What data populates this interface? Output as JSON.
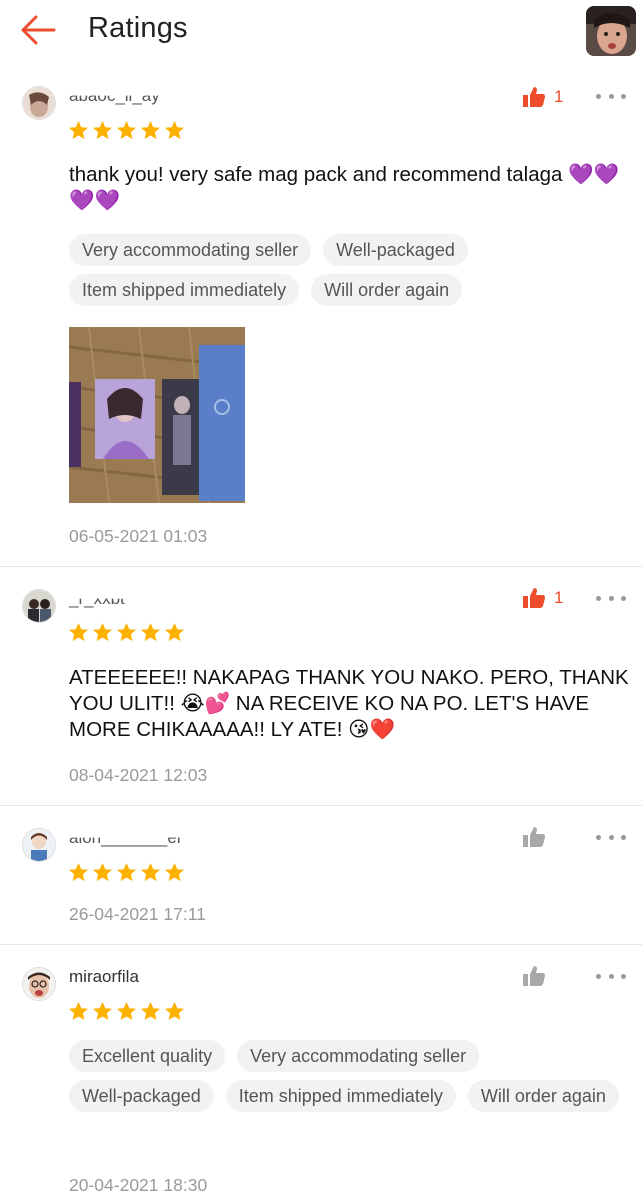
{
  "header": {
    "title": "Ratings"
  },
  "colors": {
    "accent": "#ee4d2d",
    "star": "#ffb100",
    "tag_bg": "#f2f2f2",
    "muted": "#9a9a9a"
  },
  "reviews": [
    {
      "username": "abaoc_ll_ay",
      "likes": "1",
      "liked": true,
      "rating": 5,
      "comment": "thank you! very safe mag pack and recommend talaga 💜💜💜💜",
      "tags": [
        "Very accommodating seller",
        "Well-packaged",
        "Item shipped immediately",
        "Will order again"
      ],
      "has_photo": true,
      "date": "06-05-2021 01:03"
    },
    {
      "username": "_r_xxbt",
      "likes": "1",
      "liked": true,
      "rating": 5,
      "comment": "ATEEEEEE!! NAKAPAG THANK YOU NAKO. PERO, THANK YOU ULIT!! 😭💕 NA RECEIVE KO NA PO. LET'S HAVE MORE CHIKAAAAA!! LY ATE! 😘❤️",
      "tags": [],
      "has_photo": false,
      "date": "08-04-2021 12:03"
    },
    {
      "username": "alon_______er",
      "likes": "",
      "liked": false,
      "rating": 5,
      "comment": "",
      "tags": [],
      "has_photo": false,
      "date": "26-04-2021 17:11"
    },
    {
      "username": "miraorfila",
      "likes": "",
      "liked": false,
      "rating": 5,
      "comment": "",
      "tags": [
        "Excellent quality",
        "Very accommodating seller",
        "Well-packaged",
        "Item shipped immediately",
        "Will order again"
      ],
      "has_photo": false,
      "date": "20-04-2021 18:30"
    }
  ]
}
